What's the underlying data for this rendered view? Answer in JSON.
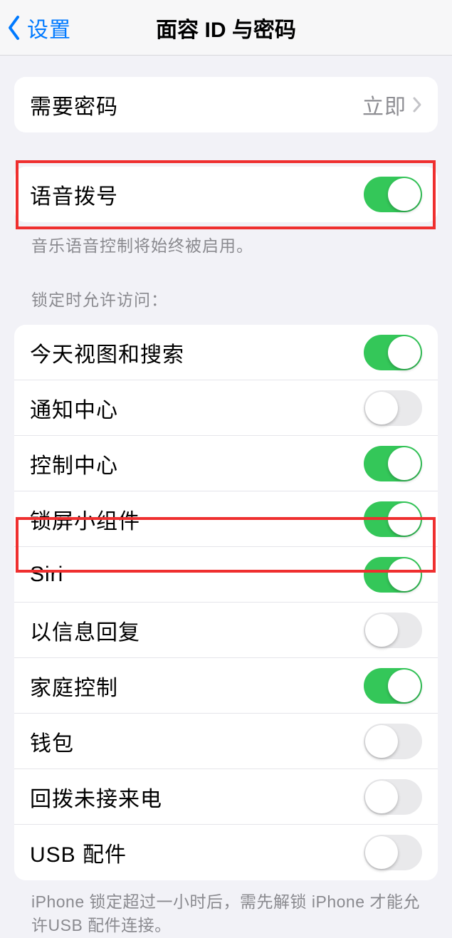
{
  "nav": {
    "back": "设置",
    "title": "面容 ID 与密码"
  },
  "group1": {
    "items": [
      {
        "label": "需要密码",
        "value": "立即"
      }
    ]
  },
  "group2": {
    "items": [
      {
        "label": "语音拨号",
        "on": true
      }
    ],
    "footer": "音乐语音控制将始终被启用。"
  },
  "lock_header": "锁定时允许访问：",
  "group3": {
    "items": [
      {
        "label": "今天视图和搜索",
        "on": true
      },
      {
        "label": "通知中心",
        "on": false
      },
      {
        "label": "控制中心",
        "on": true
      },
      {
        "label": "锁屏小组件",
        "on": true
      },
      {
        "label": "Siri",
        "on": true
      },
      {
        "label": "以信息回复",
        "on": false
      },
      {
        "label": "家庭控制",
        "on": true
      },
      {
        "label": "钱包",
        "on": false
      },
      {
        "label": "回拨未接来电",
        "on": false
      },
      {
        "label": "USB 配件",
        "on": false
      }
    ]
  },
  "bottom_footer": "iPhone 锁定超过一小时后，需先解锁 iPhone 才能允许USB 配件连接。"
}
